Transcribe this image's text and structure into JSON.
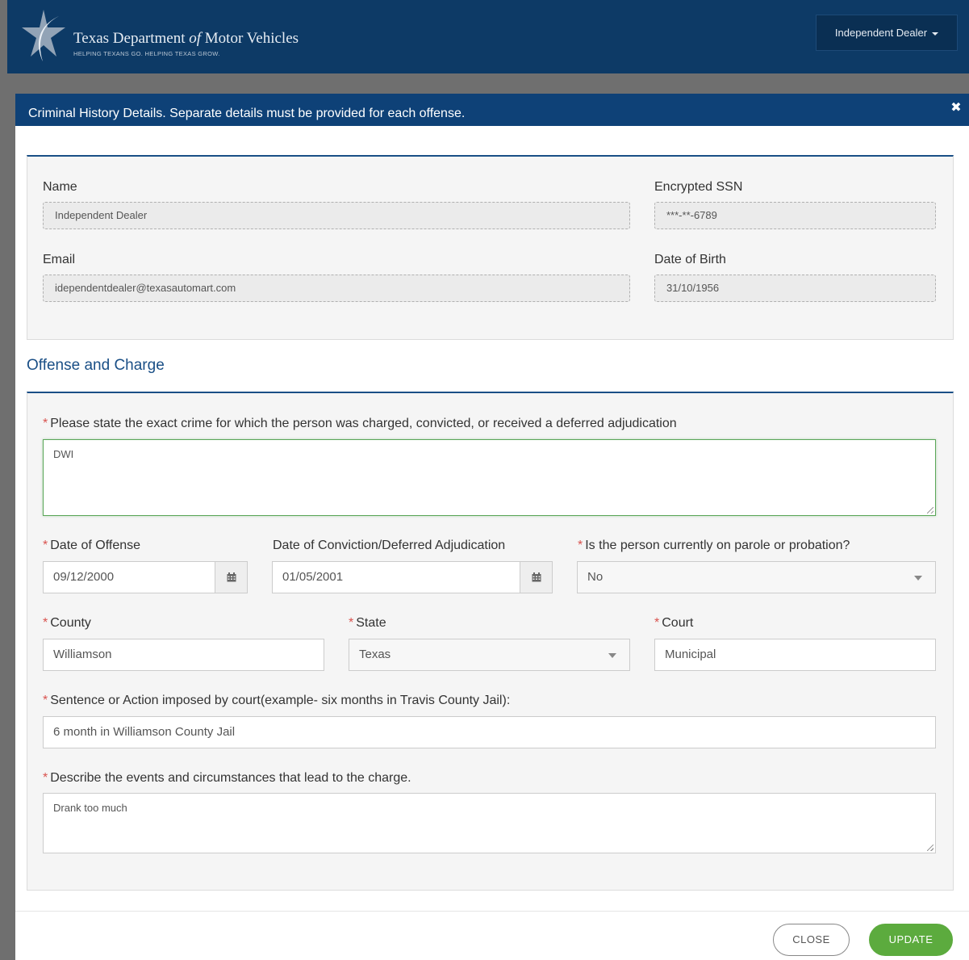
{
  "navbar": {
    "brand_title_part1": "Texas Department ",
    "brand_title_of": "of",
    "brand_title_part2": " Motor Vehicles",
    "brand_tagline": "HELPING TEXANS GO. HELPING TEXAS GROW.",
    "user_menu_label": "Independent Dealer"
  },
  "modal": {
    "title": "Criminal History Details. Separate details must be provided for each offense.",
    "close_symbol": "✖"
  },
  "personal": {
    "name_label": "Name",
    "name_value": "Independent Dealer",
    "ssn_label": "Encrypted SSN",
    "ssn_value": "***-**-6789",
    "email_label": "Email",
    "email_value": "idependentdealer@texasautomart.com",
    "dob_label": "Date of Birth",
    "dob_value": "31/10/1956"
  },
  "offense": {
    "section_title": "Offense and Charge",
    "required_mark": "*",
    "crime_label": "Please state the exact crime for which the person was charged, convicted, or received a deferred adjudication",
    "crime_value": "DWI",
    "offense_date_label": "Date of Offense",
    "offense_date_value": "09/12/2000",
    "conviction_date_label": "Date of Conviction/Deferred Adjudication",
    "conviction_date_value": "01/05/2001",
    "parole_label": "Is the person currently on parole or probation?",
    "parole_value": "No",
    "county_label": "County",
    "county_value": "Williamson",
    "state_label": "State",
    "state_value": "Texas",
    "court_label": "Court",
    "court_value": "Municipal",
    "sentence_label": "Sentence or Action imposed by court(example- six months in Travis County Jail):",
    "sentence_value": "6 month in Williamson County Jail",
    "events_label": "Describe the events and circumstances that lead to the charge.",
    "events_value": "Drank too much"
  },
  "footer": {
    "close_label": "CLOSE",
    "update_label": "UPDATE"
  },
  "colors": {
    "navbar": "#0d3a66",
    "modal_header": "#0e4177",
    "section_title": "#1a4f86",
    "update_button": "#5cab3e",
    "required": "#d9534f"
  }
}
